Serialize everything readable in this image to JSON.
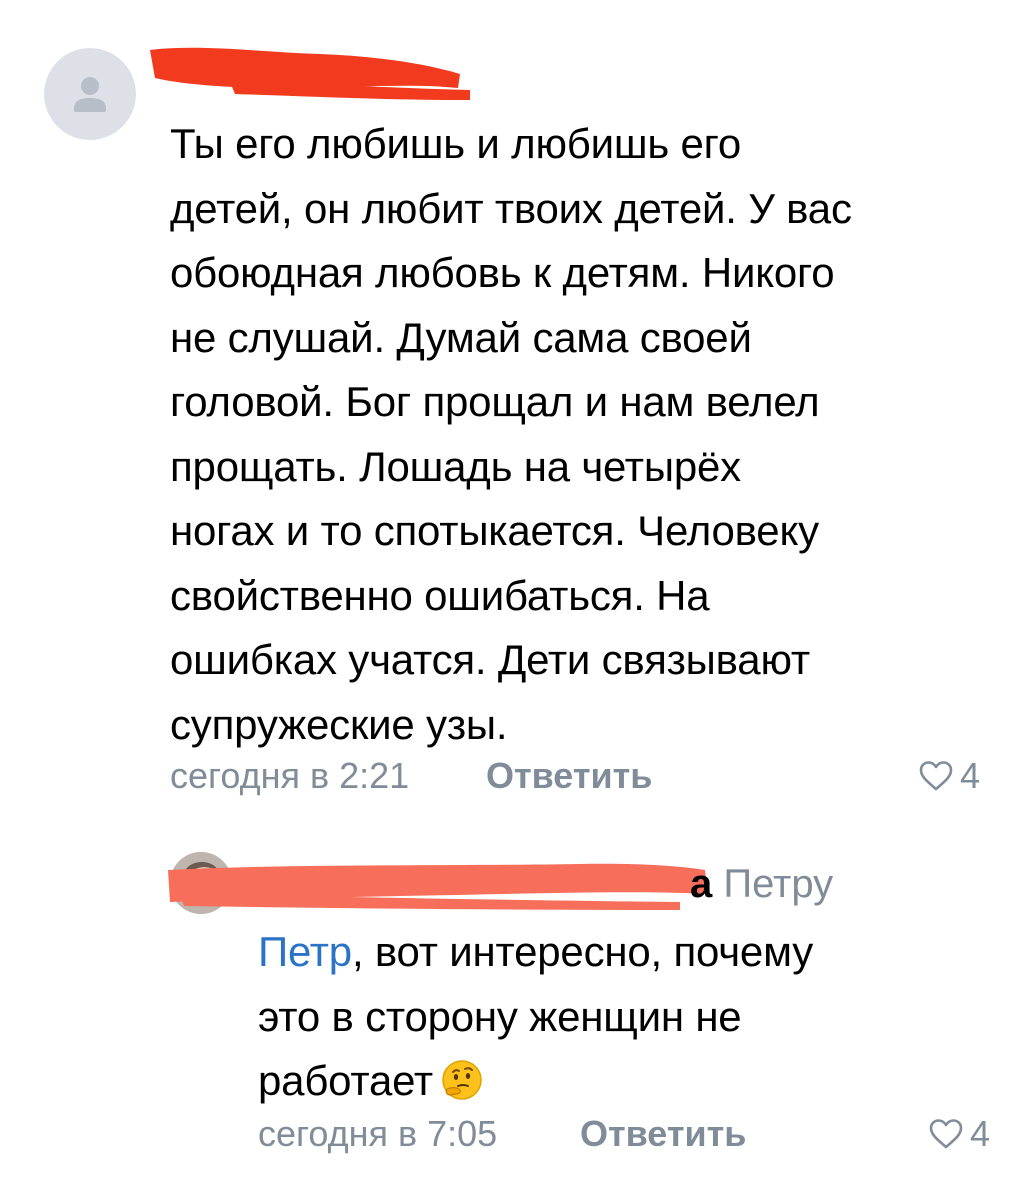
{
  "comments": [
    {
      "author_hidden": true,
      "text_lines": [
        "Ты его любишь и любишь его",
        "детей, он любит твоих детей. У вас",
        "обоюдная любовь к детям. Никого",
        "не слушай. Думай сама своей",
        "головой. Бог прощал и нам велел",
        "прощать. Лошадь на четырёх",
        "ногах и то спотыкается. Человеку",
        "свойственно ошибаться. На",
        "ошибках учатся. Дети связывают",
        "супружеские узы."
      ],
      "time": "сегодня в 2:21",
      "reply_label": "Ответить",
      "likes": "4"
    },
    {
      "author_visible_tail": "а",
      "reply_to": "Петру",
      "mention": "Петр",
      "text_first_line_rest": ", вот интересно, почему",
      "text_line_2": "это в сторону женщин не",
      "text_line_3": "работает",
      "emoji": "thinking-face",
      "time": "сегодня в 7:05",
      "reply_label": "Ответить",
      "likes": "4"
    }
  ],
  "colors": {
    "redaction": "#f23a1f",
    "meta": "#818c99",
    "link": "#2a73c7",
    "avatar_placeholder": "#dde1e7"
  }
}
